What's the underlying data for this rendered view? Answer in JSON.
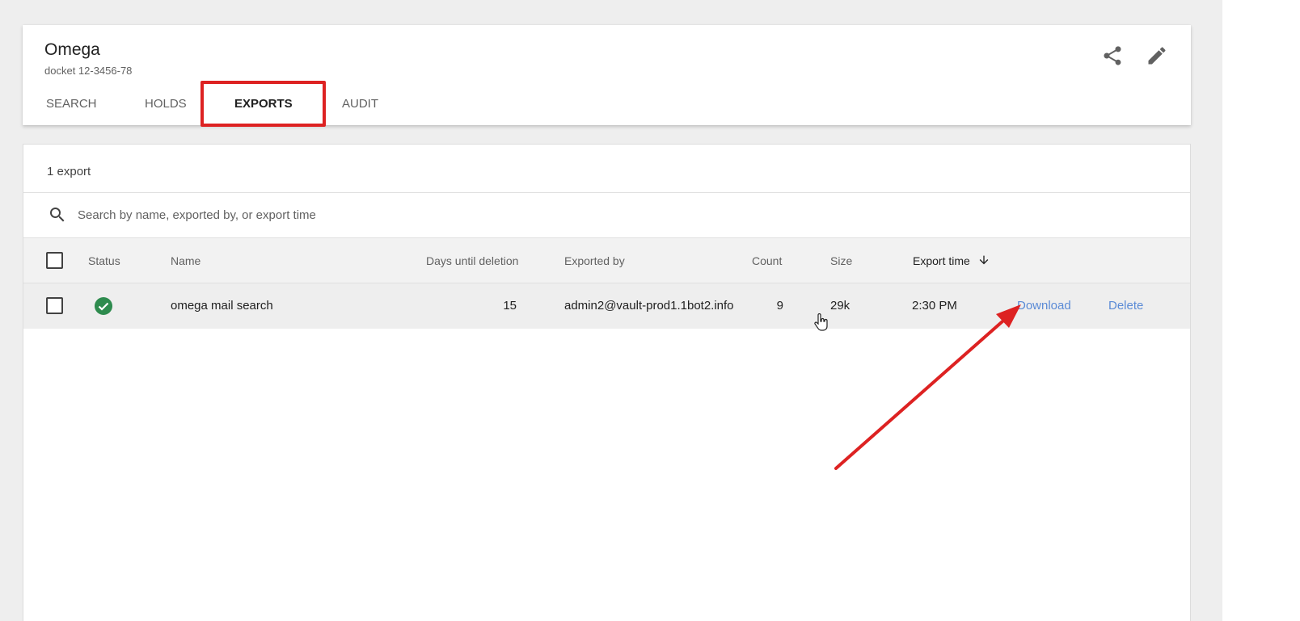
{
  "matter": {
    "title": "Omega",
    "subtitle": "docket 12-3456-78"
  },
  "tabs": [
    {
      "label": "SEARCH",
      "active": false
    },
    {
      "label": "HOLDS",
      "active": false
    },
    {
      "label": "EXPORTS",
      "active": true
    },
    {
      "label": "AUDIT",
      "active": false
    }
  ],
  "header_icons": [
    "share-icon",
    "edit-icon"
  ],
  "exports": {
    "count_label": "1 export",
    "search_placeholder": "Search by name, exported by, or export time",
    "columns": {
      "status": "Status",
      "name": "Name",
      "days": "Days until deletion",
      "exported_by": "Exported by",
      "count": "Count",
      "size": "Size",
      "export_time": "Export time",
      "sort_icon": "arrow-down-icon"
    },
    "rows": [
      {
        "status": "complete",
        "status_icon": "check-circle-icon",
        "name": "omega mail search",
        "days": "15",
        "exported_by": "admin2@vault-prod1.1bot2.info",
        "count": "9",
        "size": "29k",
        "export_time": "2:30 PM",
        "download_label": "Download",
        "delete_label": "Delete"
      }
    ]
  },
  "colors": {
    "highlight": "#dd2222",
    "link": "#5b8bd6",
    "success": "#2e8b4e"
  }
}
